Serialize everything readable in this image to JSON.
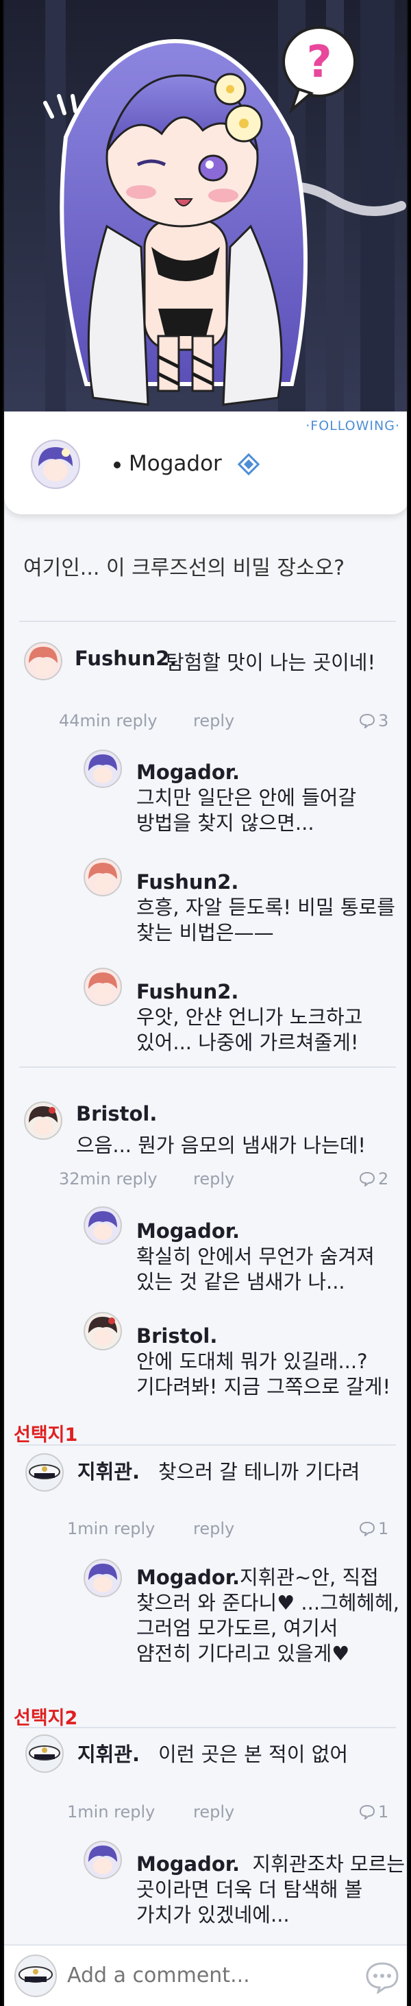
{
  "banner": {
    "question_mark": "?"
  },
  "profile": {
    "following_label": "·FOLLOWING·",
    "name": "Mogador"
  },
  "post": {
    "text": "여기인... 이 크루즈선의 비밀 장소오?"
  },
  "threads": [
    {
      "author": "Fushun2.",
      "text": "탐험할 맛이 나는 곳이네!",
      "time": "44min reply",
      "reply_label": "reply",
      "reply_count": "3",
      "replies": [
        {
          "author": "Mogador.",
          "lines": [
            "그치만 일단은 안에 들어갈",
            "방법을 찾지 않으면..."
          ]
        },
        {
          "author": "Fushun2.",
          "lines": [
            "흐흥, 자알 듣도록! 비밀 통로를",
            "찾는 비법은——"
          ]
        },
        {
          "author": "Fushun2.",
          "lines": [
            "우앗, 안샨 언니가 노크하고",
            "있어... 나중에 가르쳐줄게!"
          ]
        }
      ]
    },
    {
      "author": "Bristol.",
      "text_lines": [
        "으음... 뭔가 음모의 냄새가 나는데!"
      ],
      "time": "32min reply",
      "reply_label": "reply",
      "reply_count": "2",
      "replies": [
        {
          "author": "Mogador.",
          "lines": [
            "확실히 안에서 무언가 숨겨져",
            "있는 것 같은 냄새가 나..."
          ]
        },
        {
          "author": "Bristol.",
          "lines": [
            "안에 도대체 뭐가 있길래...?",
            "기다려봐! 지금 그쪽으로 갈게!"
          ]
        }
      ]
    },
    {
      "choice": "선택지1",
      "author": "지휘관.",
      "text": "찾으러 갈 테니까 기다려",
      "time": "1min reply",
      "reply_label": "reply",
      "reply_count": "1",
      "replies": [
        {
          "author": "Mogador.",
          "lines": [
            "지휘관~안, 직접",
            "찾으러 와 준다니♥ ...그헤헤헤,",
            "그러엄 모가도르, 여기서",
            "얌전히 기다리고 있을게♥"
          ]
        }
      ]
    },
    {
      "choice": "선택지2",
      "author": "지휘관.",
      "text": "이런 곳은 본 적이 없어",
      "time": "1min reply",
      "reply_label": "reply",
      "reply_count": "1",
      "replies": [
        {
          "author": "Mogador.",
          "lines": [
            "지휘관조차 모르는",
            "곳이라면 더욱 더 탐색해 볼",
            "가치가 있겠네에..."
          ]
        }
      ]
    }
  ],
  "composer": {
    "placeholder": "Add a comment..."
  },
  "colors": {
    "accent": "#4c8ed6",
    "choice": "#e02020",
    "background": "#f4f6fa"
  }
}
